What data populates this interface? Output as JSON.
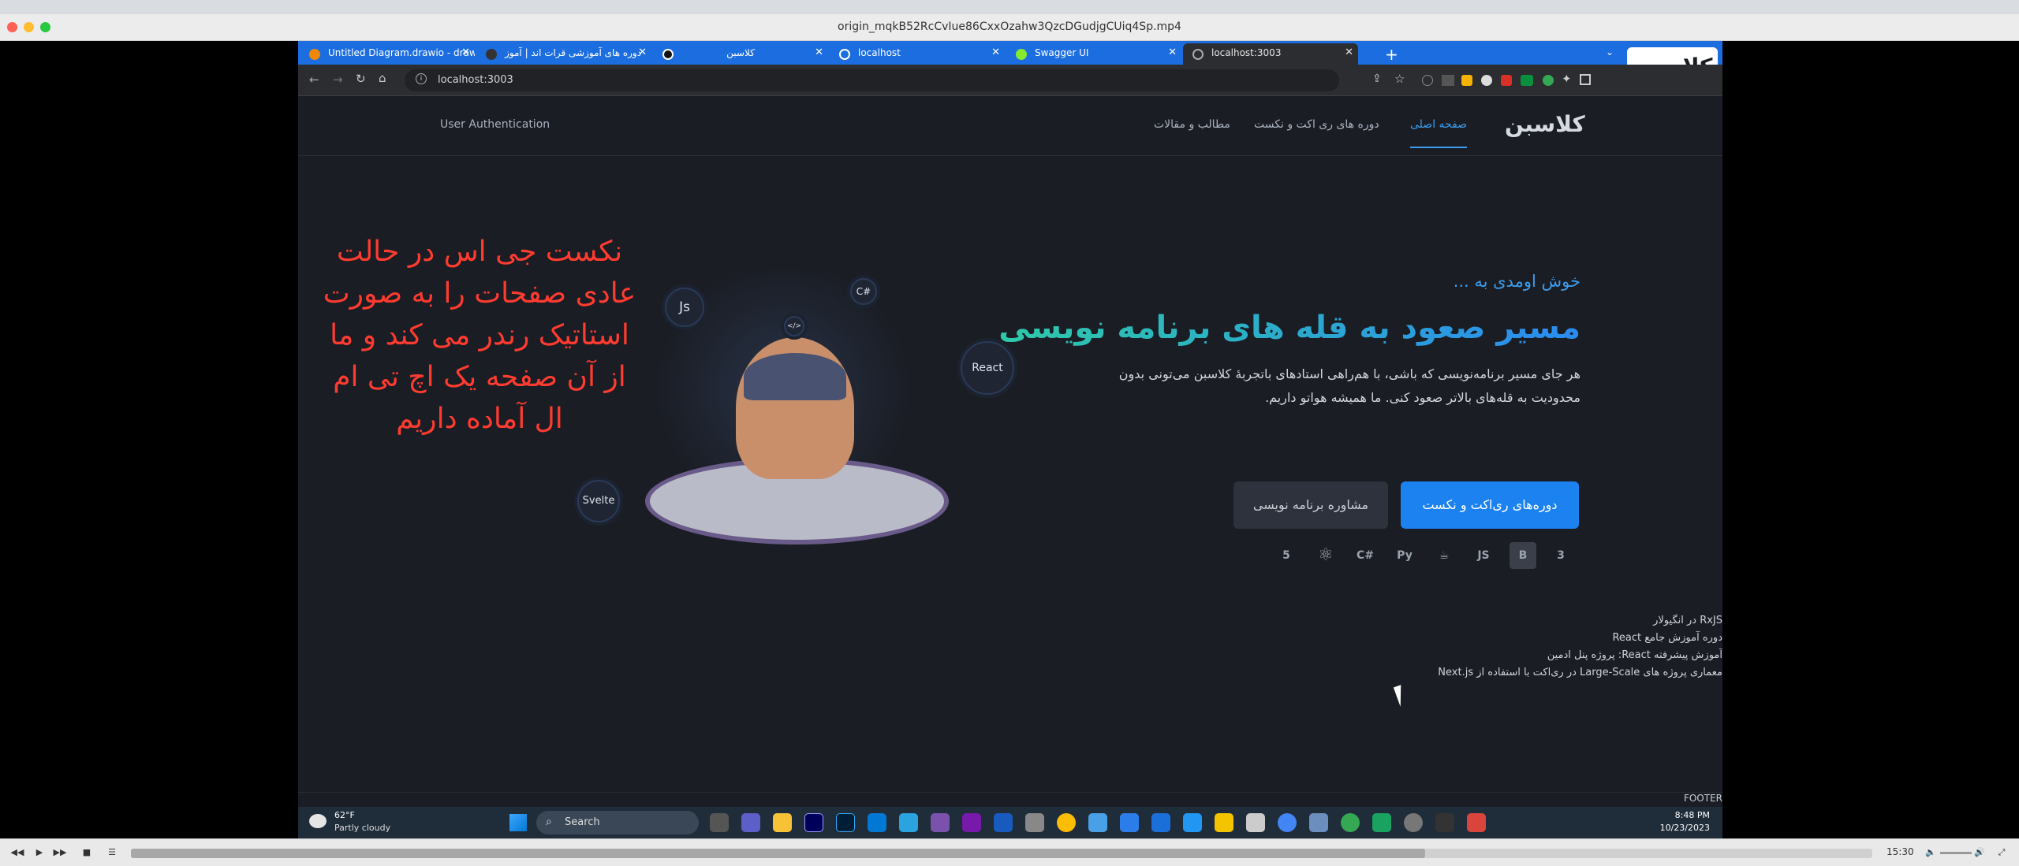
{
  "window": {
    "title": "origin_mqkB52RcCvIue86CxxOzahw3QzcDGudjgCUiq4Sp.mp4"
  },
  "browser": {
    "tabs": [
      {
        "label": "Untitled Diagram.drawio - draw"
      },
      {
        "label": "دوره های آموزشی قرات اند | آموز"
      },
      {
        "label": "کلاسبن"
      },
      {
        "label": "localhost"
      },
      {
        "label": "Swagger UI"
      },
      {
        "label": "localhost:3003"
      }
    ],
    "new_tab": "+",
    "url": "localhost:3003"
  },
  "site": {
    "logo": "کلاسبن",
    "nav": {
      "home": "صفحه اصلی",
      "courses": "دوره های ری اکت و نکست",
      "articles": "مطالب و مقالات",
      "auth": "User Authentication"
    },
    "hero": {
      "welcome": "خوش اومدی به ...",
      "title": "مسیر صعود به قله های برنامه نویسی",
      "description": "هر جای مسیر برنامه‌نویسی که باشی، با هم‌راهی استادهای باتجربهٔ کلاسبن می‌تونی بدون محدودیت به قله‌های بالاتر صعود کنی. ما همیشه هواتو داریم.",
      "primary_button": "دوره‌های ری‌اکت و نکست",
      "secondary_button": "مشاوره برنامه نویسی"
    },
    "tech_icons": [
      "html5-icon",
      "react-icon",
      "csharp-icon",
      "python-icon",
      "java-icon",
      "nodejs-icon",
      "bootstrap-icon",
      "css3-icon"
    ],
    "bubbles": {
      "js": "Js",
      "csharp": "C#",
      "react": "React",
      "svelte": "Svelte",
      "code": "</>"
    },
    "overlay_text": "نکست جی اس در حالت عادی صفحات را به صورت استاتیک رندر می کند و ما از آن صفحه یک اچ تی ام ال آماده داریم",
    "side_links": [
      "RxJS در انگیولار",
      "دوره آموزش جامع React",
      "آموزش پیشرفته React: پروژه پنل ادمین",
      "معماری پروژه های Large-Scale در ری‌اکت با استفاده از Next.js"
    ],
    "footer": "FOOTER"
  },
  "taskbar": {
    "temperature": "62°F",
    "weather": "Partly cloudy",
    "search_placeholder": "Search",
    "time": "8:48 PM",
    "date": "10/23/2023"
  },
  "player": {
    "time": "15:30",
    "progress": 0.743
  }
}
